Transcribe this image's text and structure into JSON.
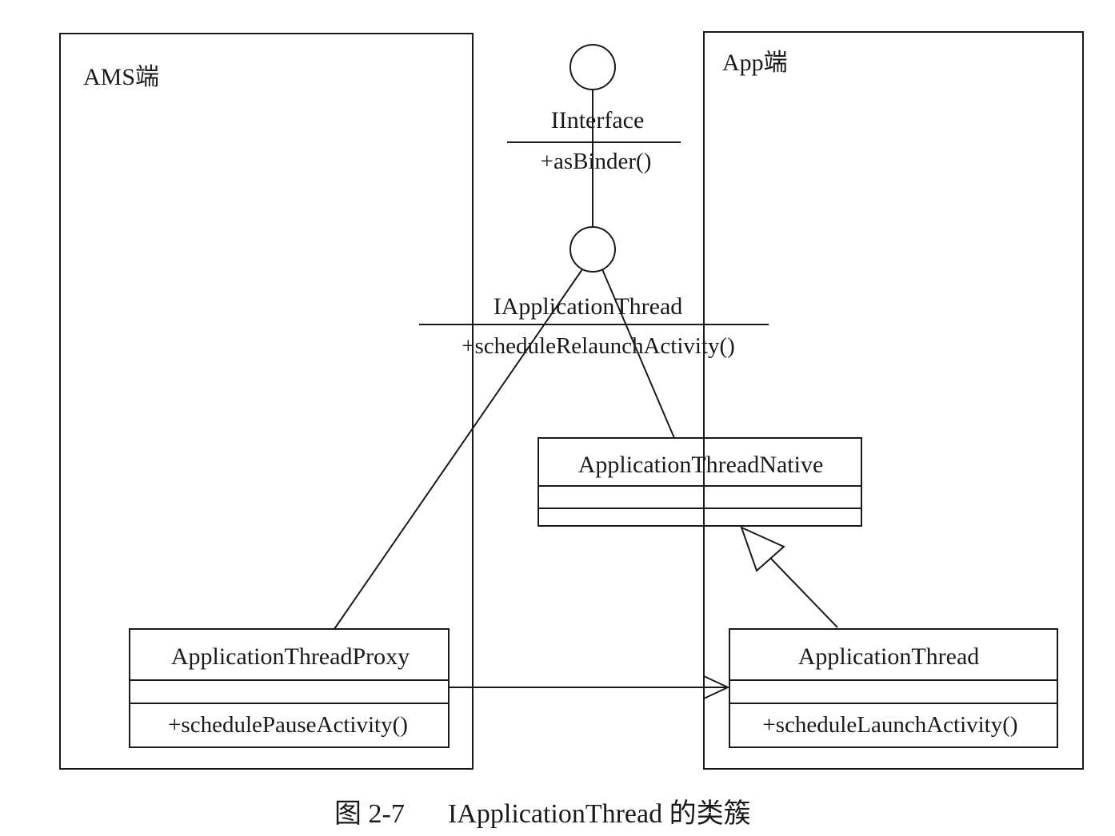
{
  "regions": {
    "ams": "AMS端",
    "app": "App端"
  },
  "interfaces": {
    "iinterface": {
      "name": "IInterface",
      "method": "+asBinder()"
    },
    "iapplication_thread": {
      "name": "IApplicationThread",
      "method": "+scheduleRelaunchActivity()"
    }
  },
  "classes": {
    "native": {
      "name": "ApplicationThreadNative"
    },
    "proxy": {
      "name": "ApplicationThreadProxy",
      "method": "+schedulePauseActivity()"
    },
    "thread": {
      "name": "ApplicationThread",
      "method": "+scheduleLaunchActivity()"
    }
  },
  "caption": {
    "figure_number": "图 2-7",
    "title": "IApplicationThread 的类簇"
  }
}
